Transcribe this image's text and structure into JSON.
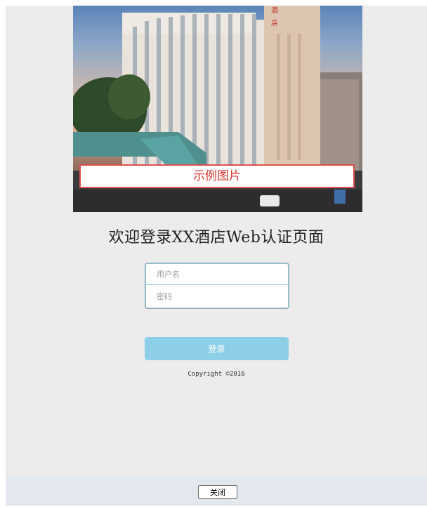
{
  "hero": {
    "caption": "示例图片",
    "sign_text": "酒\n店"
  },
  "title": "欢迎登录XX酒店Web认证页面",
  "login": {
    "username_placeholder": "用户名",
    "password_placeholder": "密码",
    "submit_label": "登录"
  },
  "copyright": "Copyright ©2016",
  "footer": {
    "close_label": "关闭"
  },
  "colors": {
    "page_bg": "#ececec",
    "button": "#8ecfe8",
    "caption_text": "#d9312b",
    "footer_bg": "#e3e8ef"
  }
}
